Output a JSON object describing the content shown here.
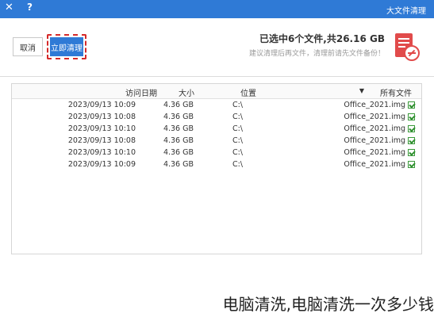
{
  "window": {
    "title": "大文件清理",
    "close_icon": "close-icon",
    "help_icon": "help-icon",
    "close_glyph": "✕",
    "help_glyph": "?"
  },
  "header": {
    "cancel_label": "取消",
    "clean_label": "立即清理",
    "summary_title": "已选中6个文件,共26.16 GB",
    "summary_sub": "建议清理后再文件，清理前请先文件备份！",
    "icon": "cleanup-app-icon"
  },
  "table": {
    "columns": {
      "name": "所有文件",
      "sort_glyph": "▼",
      "location": "位置",
      "size": "大小",
      "date": "访问日期"
    },
    "rows": [
      {
        "name": "Office_2021.img",
        "location": "C:\\",
        "size": "4.36 GB",
        "date": "2023/09/13 10:09",
        "checked": true
      },
      {
        "name": "Office_2021.img",
        "location": "C:\\",
        "size": "4.36 GB",
        "date": "2023/09/13 10:08",
        "checked": true
      },
      {
        "name": "Office_2021.img",
        "location": "C:\\",
        "size": "4.36 GB",
        "date": "2023/09/13 10:10",
        "checked": true
      },
      {
        "name": "Office_2021.img",
        "location": "C:\\",
        "size": "4.36 GB",
        "date": "2023/09/13 10:08",
        "checked": true
      },
      {
        "name": "Office_2021.img",
        "location": "C:\\",
        "size": "4.36 GB",
        "date": "2023/09/13 10:10",
        "checked": true
      },
      {
        "name": "Office_2021.img",
        "location": "C:\\",
        "size": "4.36 GB",
        "date": "2023/09/13 10:09",
        "checked": true
      }
    ]
  },
  "caption": "电脑清洗,电脑清洗一次多少钱",
  "colors": {
    "titlebar": "#2f7ad6",
    "primary_button": "#2f7ad6",
    "highlight_border": "#d52a2a",
    "checkbox": "#2f8f2f",
    "icon_red": "#e14b4b"
  }
}
